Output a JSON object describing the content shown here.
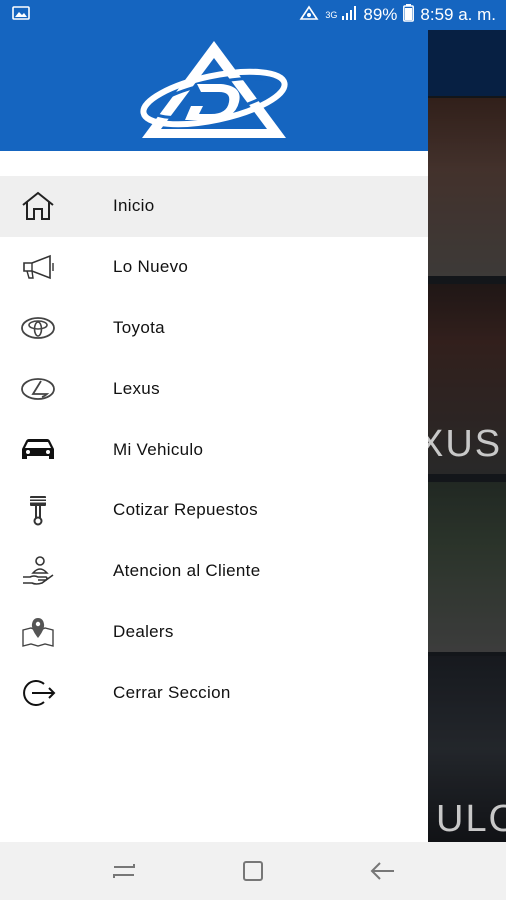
{
  "status_bar": {
    "network": "3G",
    "battery": "89%",
    "time": "8:59 a. m."
  },
  "header": {
    "logo": "delta-logo"
  },
  "menu": {
    "items": [
      {
        "label": "Inicio",
        "icon": "home-icon",
        "active": true
      },
      {
        "label": "Lo Nuevo",
        "icon": "megaphone-icon"
      },
      {
        "label": "Toyota",
        "icon": "toyota-logo-icon"
      },
      {
        "label": "Lexus",
        "icon": "lexus-logo-icon"
      },
      {
        "label": "Mi Vehiculo",
        "icon": "car-icon"
      },
      {
        "label": "Cotizar Repuestos",
        "icon": "piston-icon"
      },
      {
        "label": "Atencion al Cliente",
        "icon": "customer-service-icon"
      },
      {
        "label": "Dealers",
        "icon": "map-pin-icon"
      },
      {
        "label": "Cerrar Seccion",
        "icon": "logout-icon"
      }
    ]
  },
  "background": {
    "text_1": "XUS",
    "text_2": "ULO"
  },
  "colors": {
    "primary": "#1565c0",
    "active_row": "#efefef"
  }
}
